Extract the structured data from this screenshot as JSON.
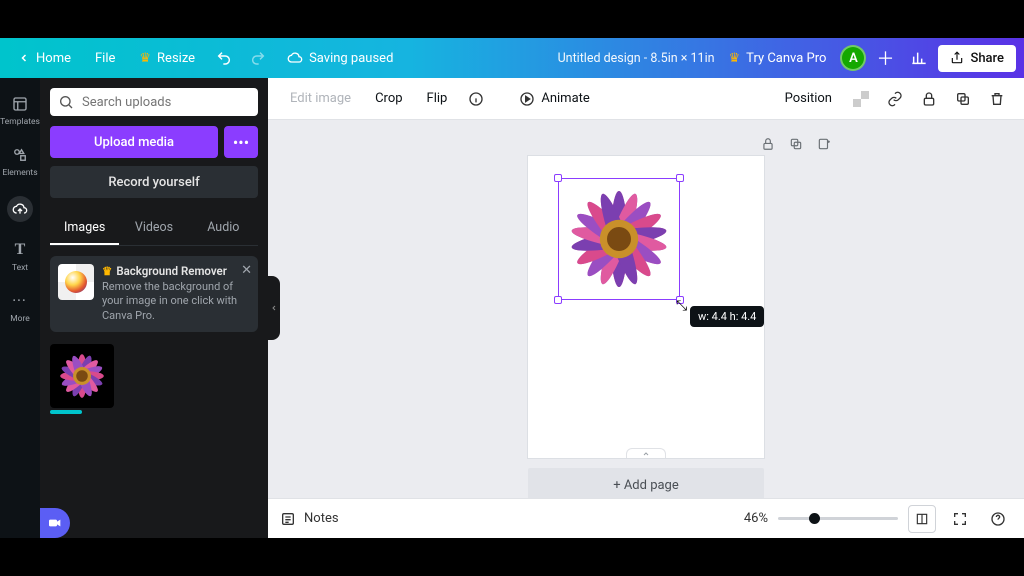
{
  "topbar": {
    "home": "Home",
    "file": "File",
    "resize": "Resize",
    "saving": "Saving paused",
    "doc_title": "Untitled design - 8.5in × 11in",
    "try_pro": "Try Canva Pro",
    "avatar_initial": "A",
    "share": "Share"
  },
  "rail": {
    "templates": "Templates",
    "elements": "Elements",
    "uploads": "Uploads",
    "text": "Text",
    "more": "More"
  },
  "panel": {
    "search_placeholder": "Search uploads",
    "upload": "Upload media",
    "record": "Record yourself",
    "tabs": {
      "images": "Images",
      "videos": "Videos",
      "audio": "Audio"
    },
    "promo": {
      "title": "Background Remover",
      "body": "Remove the background of your image in one click with Canva Pro."
    }
  },
  "context_bar": {
    "edit_image": "Edit image",
    "crop": "Crop",
    "flip": "Flip",
    "animate": "Animate",
    "position": "Position"
  },
  "canvas": {
    "size_tip": "w: 4.4 h: 4.4",
    "add_page": "+ Add page"
  },
  "bottom": {
    "notes": "Notes",
    "zoom_pct": "46%"
  }
}
